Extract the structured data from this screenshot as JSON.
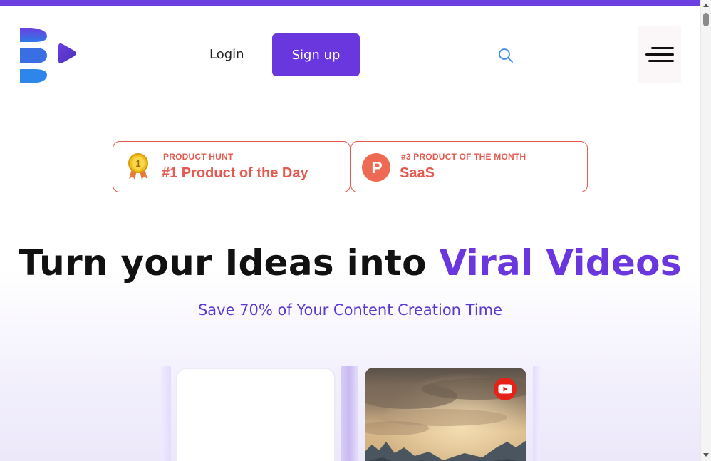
{
  "header": {
    "login_label": "Login",
    "signup_label": "Sign up"
  },
  "badges": [
    {
      "eyebrow": "PRODUCT HUNT",
      "title": "#1 Product of the Day",
      "icon": "gold-medal-icon"
    },
    {
      "eyebrow": "#3 PRODUCT OF THE MONTH",
      "title": "SaaS",
      "icon": "product-hunt-icon"
    }
  ],
  "hero": {
    "title_prefix": "Turn your Ideas into ",
    "title_accent": "Viral Videos",
    "subtitle": "Save 70% of Your Content Creation Time"
  },
  "colors": {
    "brand": "#6a37de",
    "badge": "#e5594f",
    "youtube": "#e62117"
  }
}
